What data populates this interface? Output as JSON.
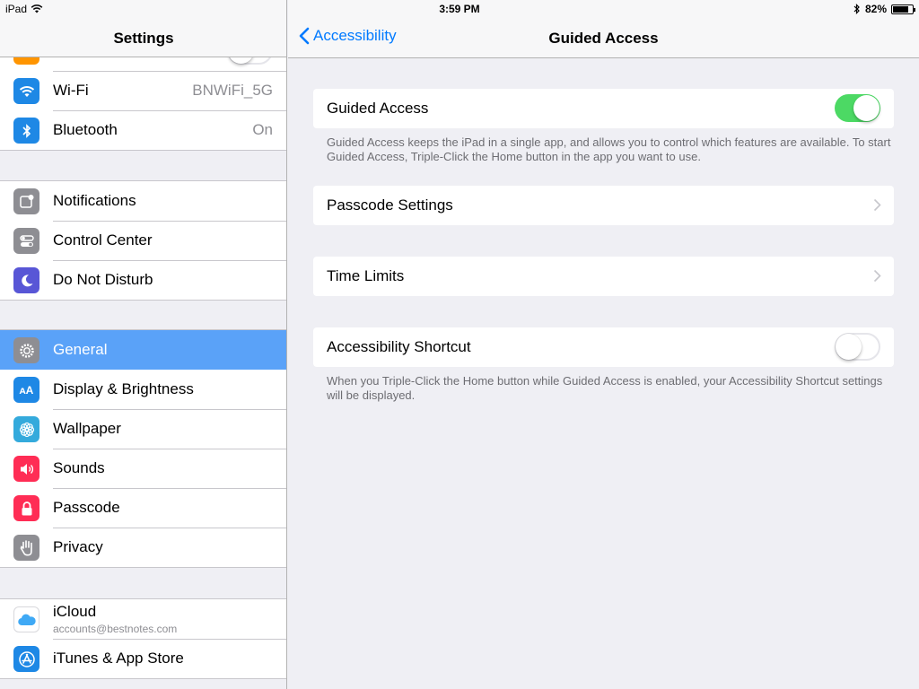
{
  "status": {
    "device": "iPad",
    "time": "3:59 PM",
    "battery_text": "82%",
    "battery_level": 0.82
  },
  "sidebar": {
    "title": "Settings",
    "wifi": {
      "label": "Wi-Fi",
      "value": "BNWiFi_5G",
      "icon": "wifi-icon",
      "color": "#1e88e5"
    },
    "bluetooth": {
      "label": "Bluetooth",
      "value": "On",
      "icon": "bluetooth-icon",
      "color": "#1e88e5"
    },
    "notifications": {
      "label": "Notifications",
      "icon": "notifications-icon",
      "color": "#8e8e93"
    },
    "control_center": {
      "label": "Control Center",
      "icon": "control-center-icon",
      "color": "#8e8e93"
    },
    "do_not_disturb": {
      "label": "Do Not Disturb",
      "icon": "moon-icon",
      "color": "#5856d6"
    },
    "general": {
      "label": "General",
      "icon": "gear-icon",
      "color": "#8e8e93"
    },
    "display": {
      "label": "Display & Brightness",
      "icon": "text-size-icon",
      "color": "#1e88e5"
    },
    "wallpaper": {
      "label": "Wallpaper",
      "icon": "flower-icon",
      "color": "#34aadc"
    },
    "sounds": {
      "label": "Sounds",
      "icon": "speaker-icon",
      "color": "#ff2d55"
    },
    "passcode": {
      "label": "Passcode",
      "icon": "lock-icon",
      "color": "#ff2d55"
    },
    "privacy": {
      "label": "Privacy",
      "icon": "hand-icon",
      "color": "#8e8e93"
    },
    "icloud": {
      "label": "iCloud",
      "sublabel": "accounts@bestnotes.com",
      "icon": "cloud-icon",
      "color": "#ffffff"
    },
    "itunes": {
      "label": "iTunes & App Store",
      "icon": "app-store-icon",
      "color": "#1e88e5"
    }
  },
  "detail": {
    "back_label": "Accessibility",
    "title": "Guided Access",
    "guided_access": {
      "label": "Guided Access",
      "enabled": true
    },
    "guided_note": "Guided Access keeps the iPad in a single app, and allows you to control which features are available. To start Guided Access, Triple-Click the Home button in the app you want to use.",
    "passcode_settings": {
      "label": "Passcode Settings"
    },
    "time_limits": {
      "label": "Time Limits"
    },
    "shortcut": {
      "label": "Accessibility Shortcut",
      "enabled": false
    },
    "shortcut_note": "When you Triple-Click the Home button while Guided Access is enabled, your Accessibility Shortcut settings will be displayed."
  }
}
